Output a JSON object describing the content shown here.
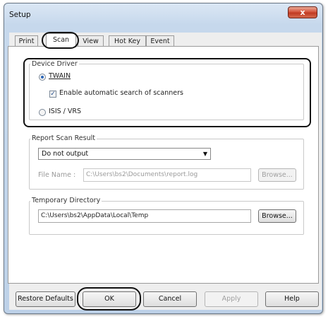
{
  "window": {
    "title": "Setup",
    "close_label": "x"
  },
  "tabs": [
    {
      "label": "Print"
    },
    {
      "label": "Scan"
    },
    {
      "label": "View"
    },
    {
      "label": "Hot Key"
    },
    {
      "label": "Event"
    }
  ],
  "device_driver": {
    "group_label": "Device Driver",
    "twain_label": "TWAIN",
    "twain_selected": true,
    "auto_search_label": "Enable automatic search of scanners",
    "auto_search_checked": true,
    "isis_label": "ISIS / VRS",
    "isis_selected": false
  },
  "report": {
    "group_label": "Report Scan Result",
    "output_selected": "Do not output",
    "file_name_label": "File Name :",
    "file_name_value": "C:\\Users\\bs2\\Documents\\report.log",
    "browse_label": "Browse..."
  },
  "temp": {
    "group_label": "Temporary Directory",
    "path_value": "C:\\Users\\bs2\\AppData\\Local\\Temp",
    "browse_label": "Browse..."
  },
  "footer": {
    "restore_label": "Restore Defaults",
    "ok_label": "OK",
    "cancel_label": "Cancel",
    "apply_label": "Apply",
    "help_label": "Help"
  },
  "check_glyph": "✓",
  "dropdown_arrow": "▼",
  "colors": {
    "title_gradient_top": "#dbe7f4",
    "close_red": "#c03a22",
    "radio_dot": "#2a66b8"
  }
}
